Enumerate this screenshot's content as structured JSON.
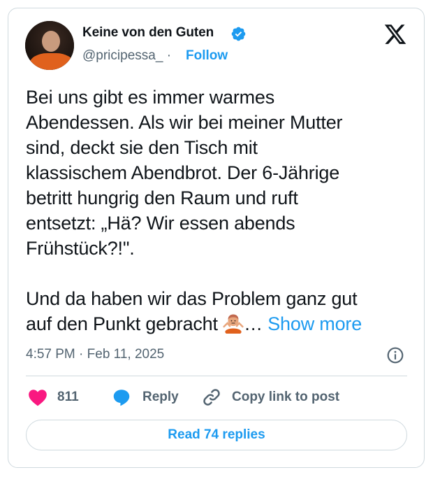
{
  "user": {
    "display_name": "Keine von den Guten",
    "handle": "@pricipessa_",
    "separator": "·",
    "follow_label": "Follow",
    "verified_color": "#1d9bf0"
  },
  "tweet": {
    "paragraph1": [
      "Bei uns gibt es immer warmes",
      "Abendessen. Als wir bei meiner Mutter",
      "sind, deckt sie den Tisch mit",
      "klassischem Abendbrot. Der 6-Jährige",
      "betritt hungrig den Raum und ruft",
      "entsetzt: „Hä? Wir essen abends",
      "Frühstück?!\"."
    ],
    "paragraph2_line1": "Und da haben wir das Problem ganz gut",
    "paragraph2_line2": "auf den Punkt gebracht",
    "ellipsis": "…",
    "show_more": "Show more",
    "emoji": "person-shrugging-emoji",
    "timestamp": "4:57 PM · Feb 11, 2025"
  },
  "actions": {
    "like_count": "811",
    "reply_label": "Reply",
    "copy_label": "Copy link to post",
    "read_replies": "Read 74 replies"
  },
  "colors": {
    "accent": "#1d9bf0",
    "like": "#f91880",
    "muted": "#536471"
  }
}
